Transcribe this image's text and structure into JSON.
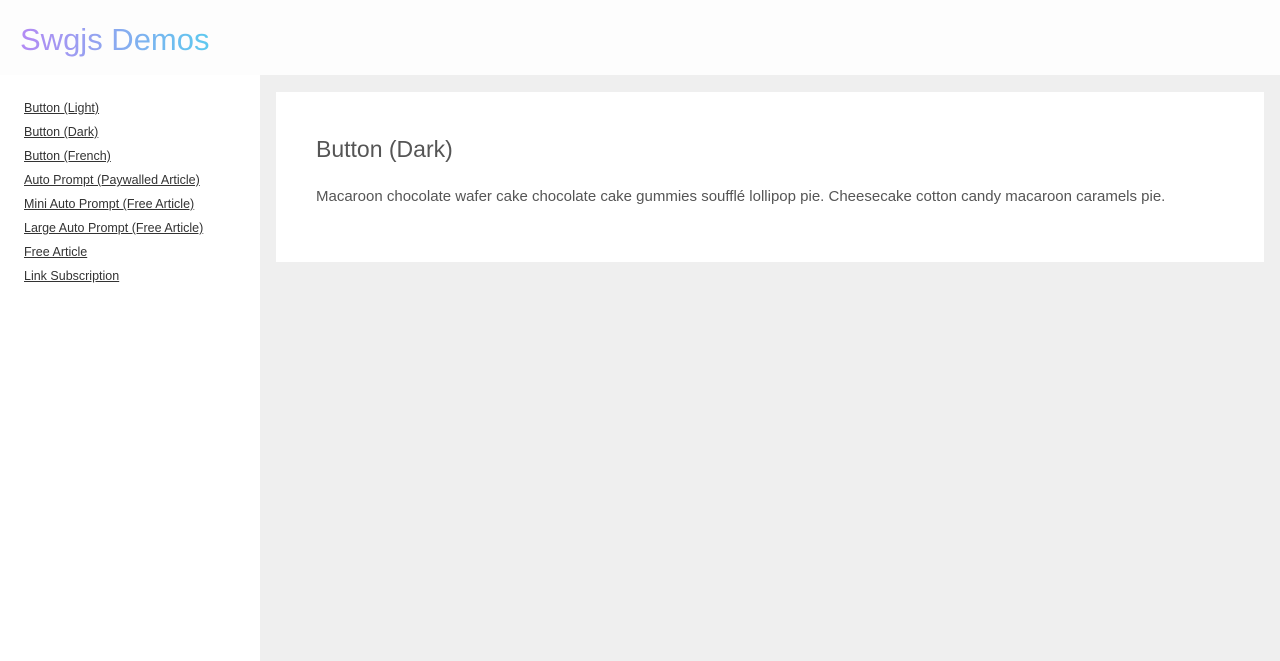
{
  "header": {
    "brand": "Swgjs Demos"
  },
  "sidebar": {
    "items": [
      {
        "label": "Button (Light)"
      },
      {
        "label": "Button (Dark)"
      },
      {
        "label": "Button (French)"
      },
      {
        "label": "Auto Prompt (Paywalled Article)"
      },
      {
        "label": "Mini Auto Prompt (Free Article)"
      },
      {
        "label": "Large Auto Prompt (Free Article)"
      },
      {
        "label": "Free Article"
      },
      {
        "label": "Link Subscription"
      }
    ]
  },
  "main": {
    "title": "Button (Dark)",
    "body": "Macaroon chocolate wafer cake chocolate cake gummies soufflé lollipop pie. Cheesecake cotton candy macaroon caramels pie."
  },
  "colors": {
    "brand_gradient_start": "#b48af4",
    "brand_gradient_end": "#5cc9ef",
    "main_background": "#efefef",
    "card_background": "#ffffff",
    "text": "#555555",
    "link": "#333333"
  }
}
